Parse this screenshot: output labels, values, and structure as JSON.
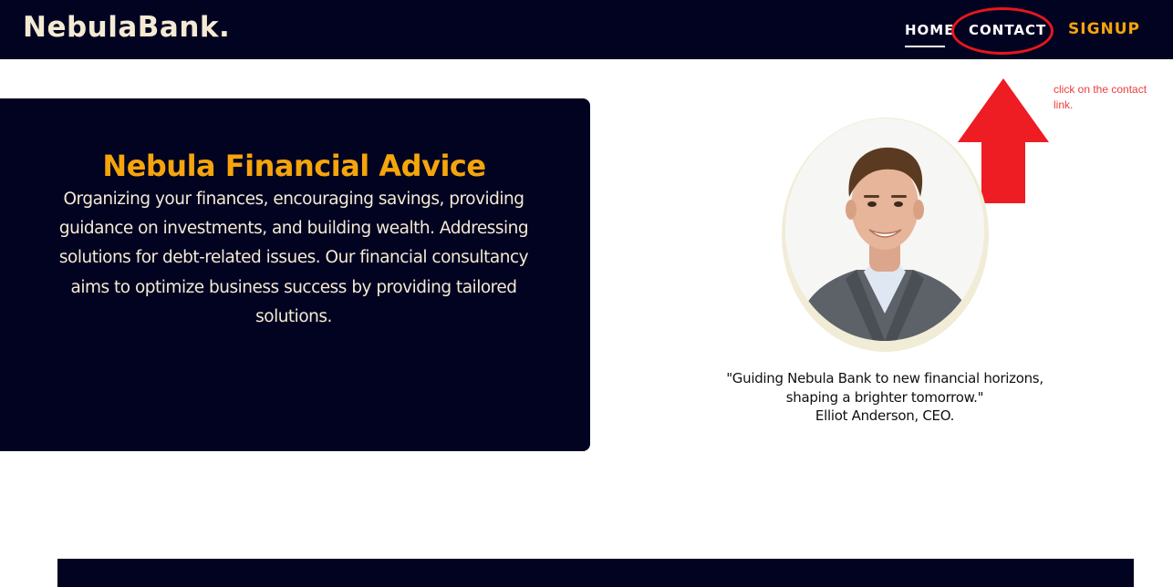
{
  "header": {
    "brand": "NebulaBank.",
    "nav": {
      "home": "HOME",
      "contact": "CONTACT",
      "signup": "SIGNUP"
    }
  },
  "annotation": {
    "note": "click on the contact link."
  },
  "advice": {
    "title": "Nebula Financial Advice",
    "body": "Organizing your finances, encouraging savings, providing guidance on investments, and building wealth. Addressing solutions for debt-related issues. Our financial consultancy aims to optimize business success by providing tailored solutions."
  },
  "quote": {
    "line1": "\"Guiding Nebula Bank to new financial horizons,",
    "line2": "shaping a brighter tomorrow.\"",
    "attribution": "Elliot Anderson, CEO."
  },
  "colors": {
    "navy": "#020221",
    "accent_orange": "#f5a50b",
    "cream": "#f3ead3",
    "annotation_red": "#e8161d"
  }
}
